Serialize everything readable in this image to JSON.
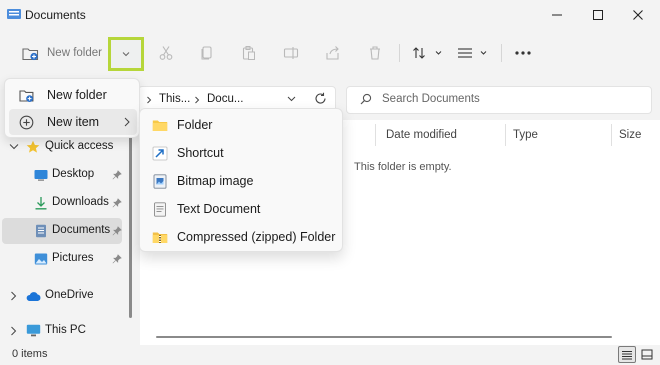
{
  "window": {
    "title": "Documents",
    "controls": {
      "minimize": "—",
      "maximize": "☐",
      "close": "✕"
    }
  },
  "toolbar": {
    "new_label": "New folder",
    "new_dropdown_highlight_color": "#b6d63a",
    "actions": [
      "cut-icon",
      "copy-icon",
      "paste-icon",
      "rename-icon",
      "share-icon",
      "delete-icon",
      "sort-icon",
      "view-icon",
      "more-icon"
    ]
  },
  "address": {
    "segments": [
      "This...",
      "Docu..."
    ]
  },
  "search": {
    "placeholder": "Search Documents"
  },
  "new_menu": {
    "items": [
      {
        "label": "New folder",
        "icon": "new-folder-icon"
      },
      {
        "label": "New item",
        "icon": "add-circle-icon",
        "has_submenu": true
      }
    ]
  },
  "new_item_submenu": {
    "items": [
      {
        "label": "Folder",
        "icon": "folder-icon"
      },
      {
        "label": "Shortcut",
        "icon": "shortcut-icon"
      },
      {
        "label": "Bitmap image",
        "icon": "bitmap-image-icon"
      },
      {
        "label": "Text Document",
        "icon": "text-document-icon"
      },
      {
        "label": "Compressed (zipped) Folder",
        "icon": "zip-folder-icon"
      }
    ]
  },
  "sidebar": {
    "quick_access": "Quick access",
    "items": [
      {
        "label": "Desktop",
        "icon": "desktop-icon",
        "pinned": true
      },
      {
        "label": "Downloads",
        "icon": "download-icon",
        "pinned": true
      },
      {
        "label": "Documents",
        "icon": "documents-icon",
        "pinned": true,
        "selected": true
      },
      {
        "label": "Pictures",
        "icon": "pictures-icon",
        "pinned": true
      }
    ],
    "onedrive": "OneDrive",
    "this_pc": "This PC"
  },
  "content": {
    "columns": [
      "Date modified",
      "Type",
      "Size"
    ],
    "empty_message": "This folder is empty."
  },
  "status": {
    "items_count": "0 items"
  }
}
